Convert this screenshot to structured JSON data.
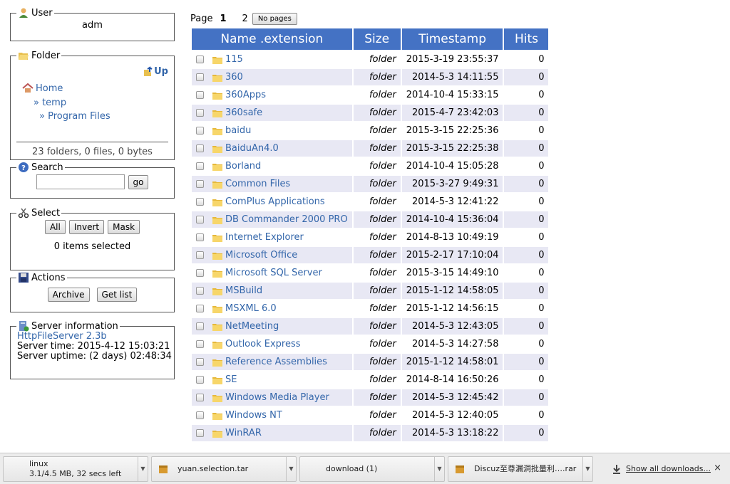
{
  "user": {
    "legend": "User",
    "name": "adm"
  },
  "folder": {
    "legend": "Folder",
    "up_label": "Up",
    "home_label": "Home",
    "path": [
      "» temp",
      "» Program Files"
    ],
    "summary": "23 folders, 0 files, 0 bytes"
  },
  "search": {
    "legend": "Search",
    "value": "",
    "go_label": "go"
  },
  "select": {
    "legend": "Select",
    "all_label": "All",
    "invert_label": "Invert",
    "mask_label": "Mask",
    "status": "0 items selected"
  },
  "actions": {
    "legend": "Actions",
    "archive_label": "Archive",
    "getlist_label": "Get list"
  },
  "server": {
    "legend": "Server information",
    "software": "HttpFileServer 2.3b",
    "time": "Server time: 2015-4-12 15:03:21",
    "uptime": "Server uptime: (2 days) 02:48:34"
  },
  "pager": {
    "label": "Page",
    "pages": [
      "1",
      "2"
    ],
    "current": "1",
    "no_pages_label": "No pages"
  },
  "table": {
    "headers": {
      "name": "Name .extension",
      "size": "Size",
      "timestamp": "Timestamp",
      "hits": "Hits"
    },
    "rows": [
      {
        "name": "115",
        "size": "folder",
        "timestamp": "2015-3-19 23:55:37",
        "hits": "0"
      },
      {
        "name": "360",
        "size": "folder",
        "timestamp": "2014-5-3 14:11:55",
        "hits": "0"
      },
      {
        "name": "360Apps",
        "size": "folder",
        "timestamp": "2014-10-4 15:33:15",
        "hits": "0"
      },
      {
        "name": "360safe",
        "size": "folder",
        "timestamp": "2015-4-7 23:42:03",
        "hits": "0"
      },
      {
        "name": "baidu",
        "size": "folder",
        "timestamp": "2015-3-15 22:25:36",
        "hits": "0"
      },
      {
        "name": "BaiduAn4.0",
        "size": "folder",
        "timestamp": "2015-3-15 22:25:38",
        "hits": "0"
      },
      {
        "name": "Borland",
        "size": "folder",
        "timestamp": "2014-10-4 15:05:28",
        "hits": "0"
      },
      {
        "name": "Common Files",
        "size": "folder",
        "timestamp": "2015-3-27 9:49:31",
        "hits": "0"
      },
      {
        "name": "ComPlus Applications",
        "size": "folder",
        "timestamp": "2014-5-3 12:41:22",
        "hits": "0"
      },
      {
        "name": "DB Commander 2000 PRO",
        "size": "folder",
        "timestamp": "2014-10-4 15:36:04",
        "hits": "0"
      },
      {
        "name": "Internet Explorer",
        "size": "folder",
        "timestamp": "2014-8-13 10:49:19",
        "hits": "0"
      },
      {
        "name": "Microsoft Office",
        "size": "folder",
        "timestamp": "2015-2-17 17:10:04",
        "hits": "0"
      },
      {
        "name": "Microsoft SQL Server",
        "size": "folder",
        "timestamp": "2015-3-15 14:49:10",
        "hits": "0"
      },
      {
        "name": "MSBuild",
        "size": "folder",
        "timestamp": "2015-1-12 14:58:05",
        "hits": "0"
      },
      {
        "name": "MSXML 6.0",
        "size": "folder",
        "timestamp": "2015-1-12 14:56:15",
        "hits": "0"
      },
      {
        "name": "NetMeeting",
        "size": "folder",
        "timestamp": "2014-5-3 12:43:05",
        "hits": "0"
      },
      {
        "name": "Outlook Express",
        "size": "folder",
        "timestamp": "2014-5-3 14:27:58",
        "hits": "0"
      },
      {
        "name": "Reference Assemblies",
        "size": "folder",
        "timestamp": "2015-1-12 14:58:01",
        "hits": "0"
      },
      {
        "name": "SE",
        "size": "folder",
        "timestamp": "2014-8-14 16:50:26",
        "hits": "0"
      },
      {
        "name": "Windows Media Player",
        "size": "folder",
        "timestamp": "2014-5-3 12:45:42",
        "hits": "0"
      },
      {
        "name": "Windows NT",
        "size": "folder",
        "timestamp": "2014-5-3 12:40:05",
        "hits": "0"
      },
      {
        "name": "WinRAR",
        "size": "folder",
        "timestamp": "2014-5-3 13:18:22",
        "hits": "0"
      }
    ]
  },
  "downloads": {
    "items": [
      {
        "name": "linux",
        "status": "3.1/4.5 MB, 32 secs left"
      },
      {
        "name": "yuan.selection.tar",
        "status": ""
      },
      {
        "name": "download (1)",
        "status": ""
      },
      {
        "name": "Discuz至尊漏洞批量利….rar",
        "status": ""
      }
    ],
    "show_all_label": "Show all downloads...",
    "close_label": "×"
  },
  "colors": {
    "header_bg": "#4472c4",
    "row_alt": "#e8e8f4",
    "link": "#3366aa"
  }
}
